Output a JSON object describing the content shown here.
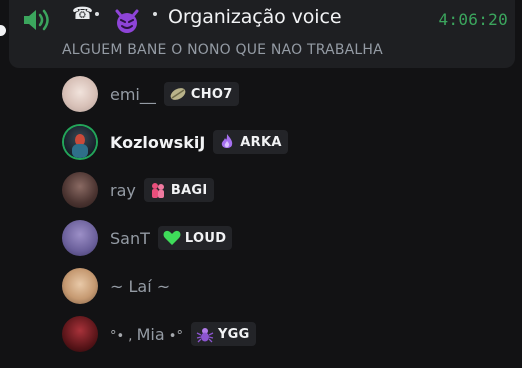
{
  "colors": {
    "background": "#121214",
    "header_bg": "#1e1f22",
    "timer": "#3ba55d",
    "speaking_ring": "#23a55a",
    "muted_text": "#949ba4",
    "bright_text": "#f2f3f5",
    "tag_bg": "#232428"
  },
  "header": {
    "voice_icon": "voice-channel-speaker-icon",
    "phone_icon": "phone-icon",
    "emoji_icon": "purple-demon-icon",
    "channel_name": "Organização voice",
    "timer": "4:06:20",
    "status": "ALGUEM BANE O NONO QUE NAO TRABALHA"
  },
  "members": [
    {
      "name": "emi__",
      "active": false,
      "speaking": false,
      "tag": {
        "icon": "leaf-icon",
        "label": "CHO7"
      }
    },
    {
      "name": "KozlowskiJ",
      "active": true,
      "speaking": true,
      "tag": {
        "icon": "purple-flame-icon",
        "label": "ARKA"
      }
    },
    {
      "name": "ray",
      "active": false,
      "speaking": false,
      "tag": {
        "icon": "pink-couple-icon",
        "label": "BAGI"
      }
    },
    {
      "name": "SanT",
      "active": false,
      "speaking": false,
      "tag": {
        "icon": "green-heart-icon",
        "label": "LOUD"
      }
    },
    {
      "name": "~ Laí ~",
      "active": false,
      "speaking": false
    },
    {
      "name": "Mia",
      "prefix": "°• ,  ",
      "suffix": "  •°",
      "active": false,
      "speaking": false,
      "tag": {
        "icon": "purple-spider-icon",
        "label": "YGG"
      }
    }
  ]
}
